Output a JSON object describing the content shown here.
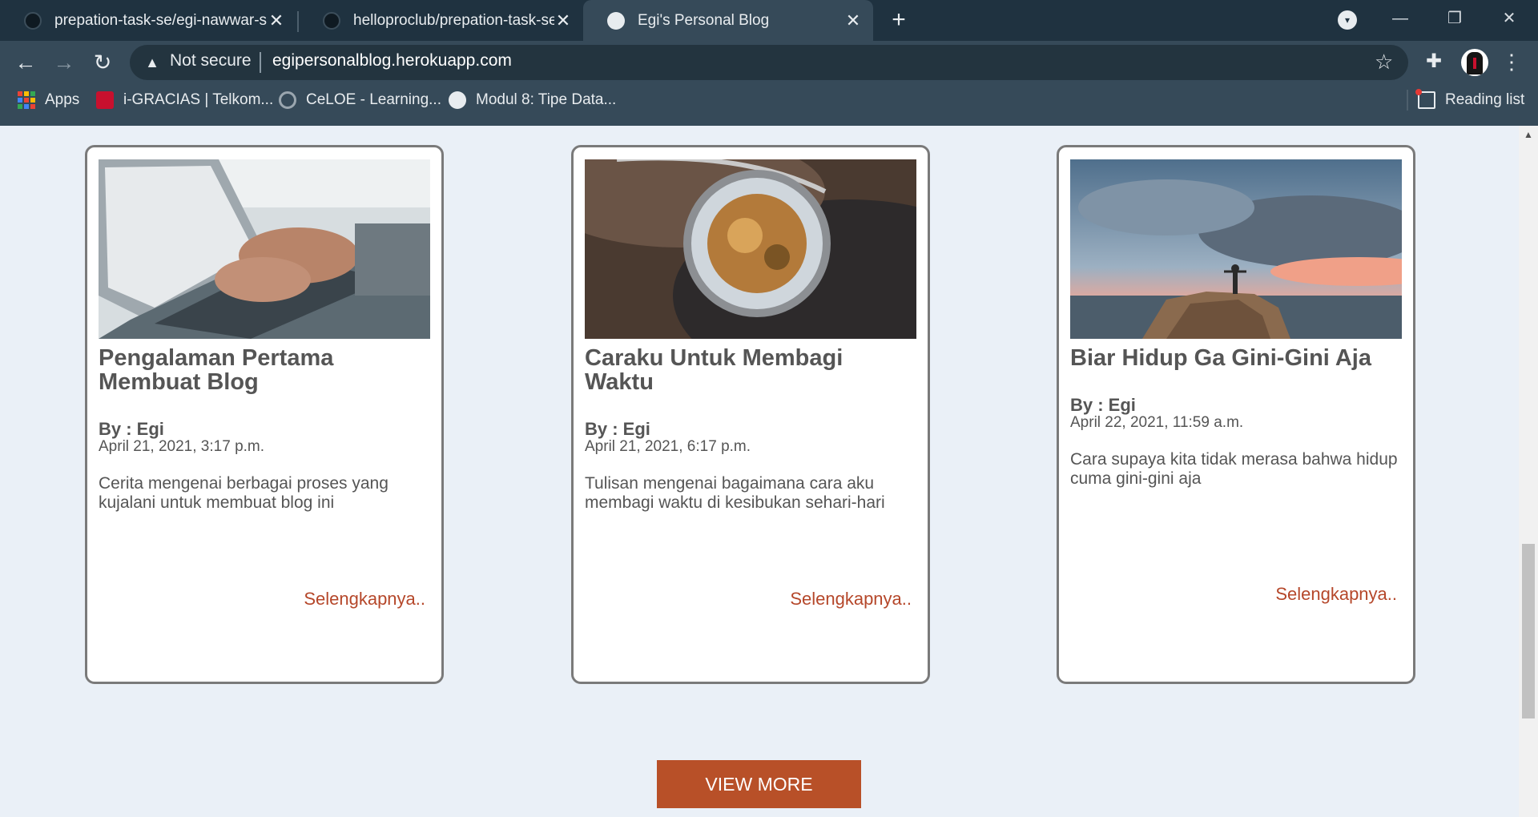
{
  "browser": {
    "tabs": [
      {
        "title": "prepation-task-se/egi-nawwar-su",
        "close": "✕"
      },
      {
        "title": "helloproclub/prepation-task-se: I",
        "close": "✕"
      },
      {
        "title": "Egi's Personal Blog",
        "close": "✕",
        "active": true
      }
    ],
    "new_tab": "+",
    "tab_search_icon": "▾",
    "window_controls": {
      "minimize": "—",
      "restore": "❐",
      "close": "✕"
    },
    "nav": {
      "back": "←",
      "forward": "→",
      "reload": "↻"
    },
    "omnibox": {
      "warning_icon": "▲",
      "security_label": "Not secure",
      "url": "egipersonalblog.herokuapp.com",
      "bookmark_star": "☆"
    },
    "extensions_icon": "✚",
    "menu_icon": "⋮",
    "bookmarks": {
      "apps": "Apps",
      "items": [
        "i-GRACIAS | Telkom...",
        "CeLOE - Learning...",
        "Modul 8: Tipe Data..."
      ],
      "reading_list": "Reading list",
      "apps_colors": [
        "#ea4335",
        "#fbbc04",
        "#34a853",
        "#4285f4",
        "#ea4335",
        "#fbbc04",
        "#34a853",
        "#4285f4",
        "#ea4335"
      ]
    }
  },
  "posts": [
    {
      "title": "Pengalaman Pertama Membuat Blog",
      "author": "By : Egi",
      "date": "April 21, 2021, 3:17 p.m.",
      "description": "Cerita mengenai berbagai proses yang kujalani untuk membuat blog ini",
      "read_more": "Selengkapnya..",
      "image": "laptop-typing"
    },
    {
      "title": "Caraku Untuk Membagi Waktu",
      "author": "By : Egi",
      "date": "April 21, 2021, 6:17 p.m.",
      "description": "Tulisan mengenai bagaimana cara aku membagi waktu di kesibukan sehari-hari",
      "read_more": "Selengkapnya..",
      "image": "pocket-watch"
    },
    {
      "title": "Biar Hidup Ga Gini-Gini Aja",
      "author": "By : Egi",
      "date": "April 22, 2021, 11:59 a.m.",
      "description": "Cara supaya kita tidak merasa bahwa hidup cuma gini-gini aja",
      "read_more": "Selengkapnya..",
      "image": "man-on-mountain"
    }
  ],
  "view_more": "VIEW MORE",
  "colors": {
    "page_bg": "#eaf0f7",
    "accent": "#b85028",
    "link": "#b5472a",
    "text": "#555555",
    "card_border": "#7a7a7a"
  }
}
